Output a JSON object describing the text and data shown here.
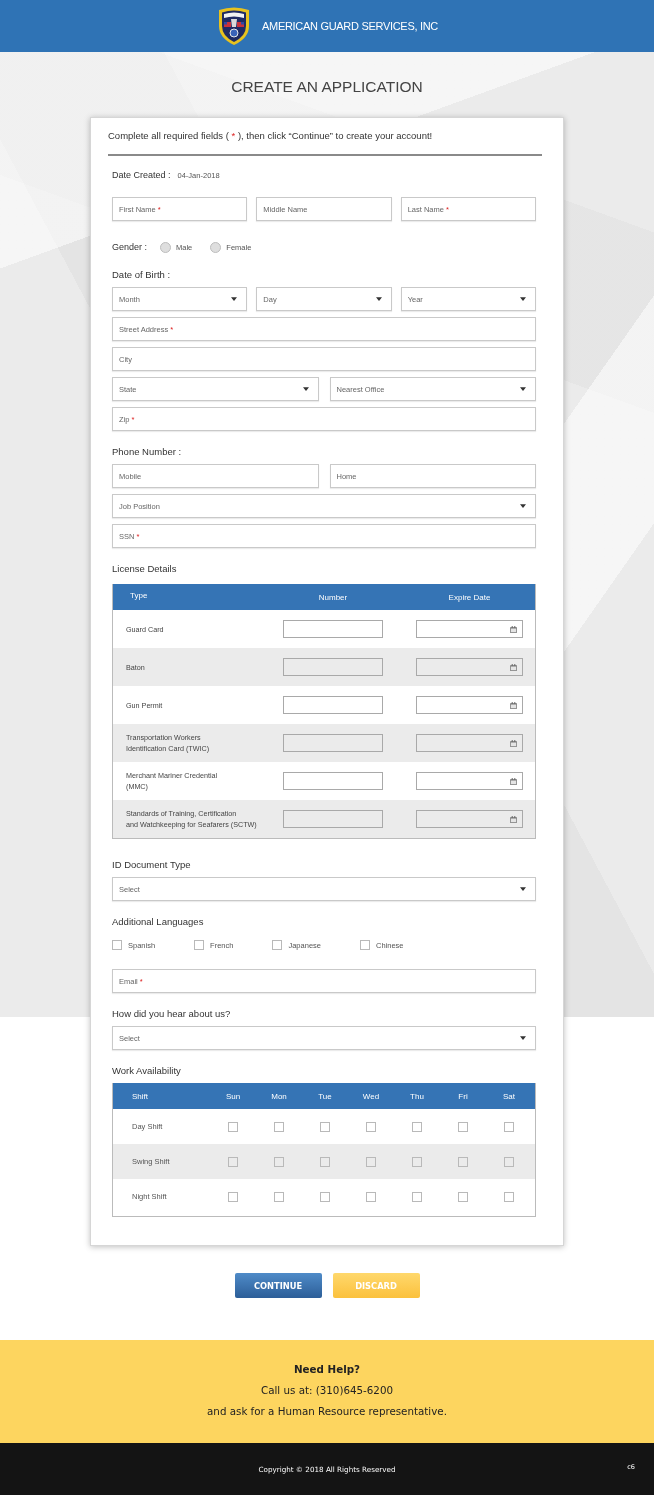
{
  "header": {
    "company_name": "AMERICAN GUARD SERVICES, INC"
  },
  "page_title": "CREATE AN APPLICATION",
  "form": {
    "intro": {
      "before": "Complete all required fields ( ",
      "required_mark": "*",
      "after": " ), then click “Continue” to create your account!"
    },
    "items": [
      {
        "kind": "info",
        "label": "Date Created :",
        "value": "04-Jan-2018"
      },
      {
        "kind": "fields",
        "fields": [
          {
            "kind": "text",
            "placeholder": "First Name",
            "required_mark": "*"
          },
          {
            "kind": "text",
            "placeholder": "Middle Name"
          },
          {
            "kind": "text",
            "placeholder": "Last Name",
            "required_mark": "*"
          }
        ]
      },
      {
        "kind": "radios",
        "label": "Gender :",
        "options": [
          {
            "label": "Male",
            "selected": false
          },
          {
            "label": "Female",
            "selected": false
          }
        ]
      },
      {
        "kind": "heading",
        "text": "Date of Birth :"
      },
      {
        "kind": "fields",
        "fields": [
          {
            "kind": "select",
            "placeholder": "Month"
          },
          {
            "kind": "select",
            "placeholder": "Day"
          },
          {
            "kind": "select",
            "placeholder": "Year"
          }
        ]
      },
      {
        "kind": "fields",
        "fields": [
          {
            "kind": "text",
            "placeholder": "Street Address",
            "required_mark": "*"
          }
        ]
      },
      {
        "kind": "fields",
        "fields": [
          {
            "kind": "text",
            "placeholder": "City"
          }
        ]
      },
      {
        "kind": "fields",
        "fields": [
          {
            "kind": "select",
            "placeholder": "State"
          },
          {
            "kind": "select",
            "placeholder": "Nearest Office"
          }
        ]
      },
      {
        "kind": "fields",
        "fields": [
          {
            "kind": "text",
            "placeholder": "Zip",
            "required_mark": "*"
          }
        ]
      },
      {
        "kind": "heading",
        "text": "Phone Number :"
      },
      {
        "kind": "fields",
        "fields": [
          {
            "kind": "text",
            "placeholder": "Mobile"
          },
          {
            "kind": "text",
            "placeholder": "Home"
          }
        ]
      },
      {
        "kind": "fields",
        "fields": [
          {
            "kind": "select",
            "placeholder": "Job Position"
          }
        ]
      },
      {
        "kind": "fields",
        "fields": [
          {
            "kind": "text",
            "placeholder": "SSN",
            "required_mark": "*"
          }
        ]
      },
      {
        "kind": "heading",
        "text": "License Details"
      },
      {
        "kind": "license_table",
        "columns": [
          "Type",
          "Number",
          "Expire Date"
        ],
        "rows": [
          {
            "type": "Guard Card"
          },
          {
            "type": "Baton"
          },
          {
            "type": "Gun Permit"
          },
          {
            "type": "Transportation Workers\nIdentification Card (TWIC)"
          },
          {
            "type": "Merchant Mariner Credential\n(MMC)"
          },
          {
            "type": "Standards of Training, Certification\nand Watchkeeping for Seafarers (SCTW)"
          }
        ]
      },
      {
        "kind": "heading",
        "text": "ID Document Type"
      },
      {
        "kind": "fields",
        "fields": [
          {
            "kind": "select",
            "placeholder": "Select"
          }
        ]
      },
      {
        "kind": "heading",
        "text": "Additional Languages"
      },
      {
        "kind": "checkboxes",
        "options": [
          {
            "label": "Spanish",
            "checked": false
          },
          {
            "label": "French",
            "checked": false
          },
          {
            "label": "Japanese",
            "checked": false
          },
          {
            "label": "Chinese",
            "checked": false
          }
        ]
      },
      {
        "kind": "fields",
        "fields": [
          {
            "kind": "text",
            "placeholder": "Email",
            "required_mark": "*"
          }
        ]
      },
      {
        "kind": "heading",
        "text": "How did you hear about us?"
      },
      {
        "kind": "fields",
        "fields": [
          {
            "kind": "select",
            "placeholder": "Select"
          }
        ]
      },
      {
        "kind": "heading",
        "text": "Work Availability"
      },
      {
        "kind": "availability_table",
        "columns": [
          "Shift",
          "Sun",
          "Mon",
          "Tue",
          "Wed",
          "Thu",
          "Fri",
          "Sat"
        ],
        "rows": [
          {
            "shift": "Day Shift",
            "days": [
              {
                "checked": false
              },
              {
                "checked": false
              },
              {
                "checked": false
              },
              {
                "checked": false
              },
              {
                "checked": false
              },
              {
                "checked": false
              },
              {
                "checked": false
              }
            ]
          },
          {
            "shift": "Swing Shift",
            "days": [
              {
                "checked": false
              },
              {
                "checked": false
              },
              {
                "checked": false
              },
              {
                "checked": false
              },
              {
                "checked": false
              },
              {
                "checked": false
              },
              {
                "checked": false
              }
            ]
          },
          {
            "shift": "Night Shift",
            "days": [
              {
                "checked": false
              },
              {
                "checked": false
              },
              {
                "checked": false
              },
              {
                "checked": false
              },
              {
                "checked": false
              },
              {
                "checked": false
              },
              {
                "checked": false
              }
            ]
          }
        ]
      }
    ]
  },
  "buttons": [
    {
      "label": "CONTINUE",
      "kind": "primary"
    },
    {
      "label": "DISCARD",
      "kind": "secondary"
    }
  ],
  "help": {
    "title": "Need Help?",
    "lines": [
      "Call us at: (310)645-6200",
      "and ask for a Human Resource representative."
    ]
  },
  "footer": {
    "copyright": "Copyright © 2018 All Rights Reserved",
    "code": "c6"
  }
}
